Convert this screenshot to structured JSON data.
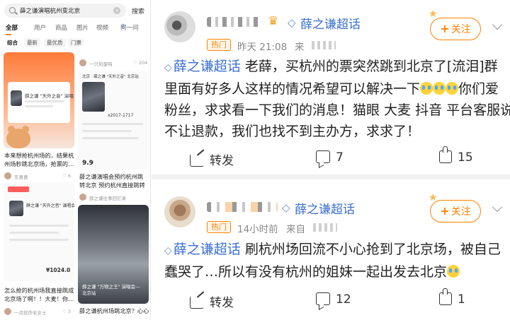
{
  "left_app": {
    "search": {
      "query": "薛之谦演唱杭州变北京",
      "clear_icon": "close-circle-icon",
      "button": "搜索"
    },
    "tabs": [
      "全部",
      "用户",
      "商品",
      "图片",
      "视频",
      "问一问"
    ],
    "chips": [
      "综合",
      "最新",
      "最优质",
      "门票"
    ],
    "feed": {
      "col1_small_top": "薛之谦 \"天外之音\" 演唱会",
      "col1_caption1": "本来想抢杭州场的，结果杭州场秒跳北京场，抢票的…",
      "col1_author1": "东喜喜",
      "col1_likes1": "6",
      "col1_card2_title": "薛之谦 \"天外之音\" 演唱会—北京站",
      "col1_price": "¥1024.0",
      "col1_caption2": "怎么抢的杭州场我直接跳成北京场了啊！！大麦！你…",
      "col1_author2": "一点就炸毛女士",
      "col1_likes2": "3",
      "col2_author_top": "一只煎蛋喵",
      "col2_likes_top": "204",
      "col2_ticket_header": "北京 · 薛之谦 \"天外之音\" 北京站",
      "col2_date": "x2017-1717",
      "col2_price_tag": "9.9",
      "col2_caption1": "薛之谦演唱会预约杭州跳转北京 预约杭州直接跳转北…",
      "col2_author1": "薛之谦往事回忆录",
      "col2_poster_title": "薛之谦 \"万物之王\" 演唱会—北京站",
      "col2_caption2": "薛之谦杭州场跳北京？心心"
    }
  },
  "posts": [
    {
      "hot_badge": "热门",
      "time": "昨天 21:08",
      "from_prefix": "来",
      "super_topic": "薛之谦超话",
      "follow": "关注",
      "body_tag": "薛之谦超话",
      "body_line1": " 老薛，买杭州的票突然跳到北京了[流泪]群",
      "body_line2a": "里面有好多人这样的情况希望可以解决一下",
      "body_line2b": "你们爱",
      "body_line3": "粉丝，求求看一下我们的消息！猫眼 大麦 抖音 平台客服说",
      "body_line4": "不让退款，我们也找不到主办方，求求了！",
      "share": "转发",
      "comments": "7",
      "likes": "15"
    },
    {
      "hot_badge": "热门",
      "time": "14小时前",
      "from_prefix": "来自",
      "super_topic": "薛之谦超话",
      "follow": "关注",
      "body_tag": "薛之谦超话",
      "body_line1": " 刷杭州场回流不小心抢到了北京场，被自己",
      "body_line2": "蠢哭了…所以有没有杭州的姐妹一起出发去北京",
      "share": "转发",
      "comments": "12",
      "likes": "1"
    }
  ]
}
